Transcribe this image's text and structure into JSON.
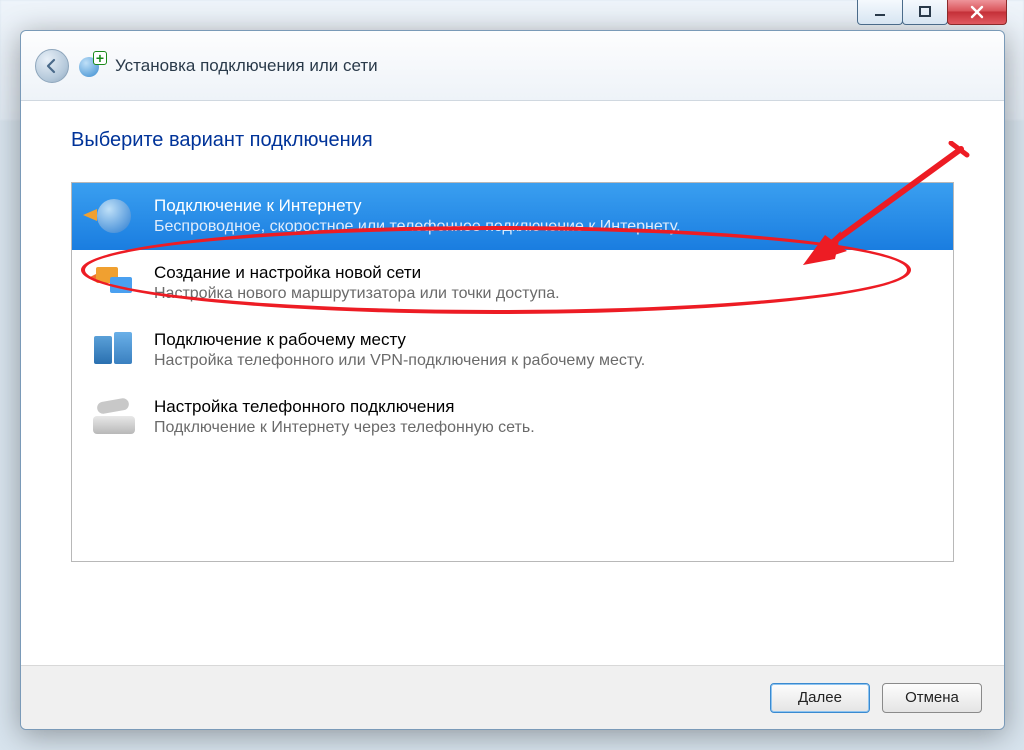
{
  "window": {
    "title": "Установка подключения или сети"
  },
  "page": {
    "heading": "Выберите вариант подключения"
  },
  "options": [
    {
      "title": "Подключение к Интернету",
      "desc": "Беспроводное, скоростное или телефонное подключение к Интернету.",
      "selected": true,
      "icon": "internet"
    },
    {
      "title": "Создание и настройка новой сети",
      "desc": "Настройка нового маршрутизатора или точки доступа.",
      "selected": false,
      "icon": "newnet"
    },
    {
      "title": "Подключение к рабочему месту",
      "desc": "Настройка телефонного или VPN-подключения к рабочему месту.",
      "selected": false,
      "icon": "work"
    },
    {
      "title": "Настройка телефонного подключения",
      "desc": "Подключение к Интернету через телефонную сеть.",
      "selected": false,
      "icon": "phone"
    }
  ],
  "buttons": {
    "next": "Далее",
    "cancel": "Отмена"
  },
  "annotation": {
    "kind": "ellipse-and-arrow",
    "color": "#ed1c24"
  }
}
